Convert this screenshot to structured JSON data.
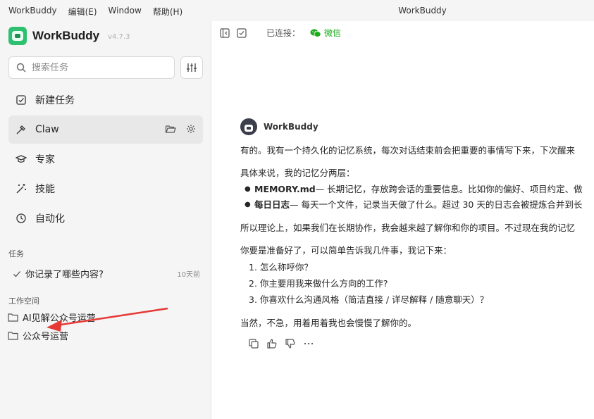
{
  "window": {
    "title": "WorkBuddy",
    "menu": [
      {
        "label": "WorkBuddy"
      },
      {
        "label": "编辑(E)"
      },
      {
        "label": "Window"
      },
      {
        "label": "帮助(H)"
      }
    ]
  },
  "sidebar": {
    "app_name": "WorkBuddy",
    "version": "v4.7.3",
    "search_placeholder": "搜索任务",
    "nav": [
      {
        "label": "新建任务",
        "icon": "edit-icon"
      },
      {
        "label": "Claw",
        "icon": "claw-icon",
        "active": true
      },
      {
        "label": "专家",
        "icon": "graduation-cap-icon"
      },
      {
        "label": "技能",
        "icon": "magic-wand-icon"
      },
      {
        "label": "自动化",
        "icon": "clock-icon"
      }
    ],
    "tasks_label": "任务",
    "task": {
      "title": "你记录了哪些内容?",
      "time": "10天前"
    },
    "workspace_label": "工作空间",
    "workspaces": [
      {
        "label": "AI见解公众号运营"
      },
      {
        "label": "公众号运营"
      }
    ]
  },
  "toolbar": {
    "connected_label": "已连接：",
    "channel": "微信"
  },
  "chat": {
    "bot_name": "WorkBuddy",
    "p1": "有的。我有一个持久化的记忆系统，每次对话结束前会把重要的事情写下来，下次醒来",
    "p2": "具体来说，我的记忆分两层：",
    "bullets": [
      {
        "bold": "MEMORY.md",
        "text": " — 长期记忆，存放跨会话的重要信息。比如你的偏好、项目约定、做"
      },
      {
        "bold": "每日日志",
        "text": " — 每天一个文件，记录当天做了什么。超过 30 天的日志会被提炼合并到长"
      }
    ],
    "p3": "所以理论上，如果我们在长期协作，我会越来越了解你和你的项目。不过现在我的记忆",
    "p4": "你要是准备好了，可以简单告诉我几件事，我记下来：",
    "list": [
      "1. 怎么称呼你？",
      "2. 你主要用我来做什么方向的工作?",
      "3. 你喜欢什么沟通风格（简洁直接 / 详尽解释 / 随意聊天）？"
    ],
    "p5": "当然，不急，用着用着我也会慢慢了解你的。"
  },
  "colors": {
    "accent_green": "#2fbf71",
    "wechat_green": "#1aad19",
    "arrow_red": "#e53935"
  }
}
